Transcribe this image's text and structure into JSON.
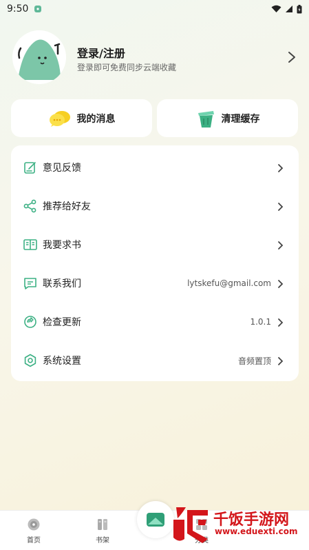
{
  "status_bar": {
    "time": "9:50"
  },
  "profile": {
    "title": "登录/注册",
    "subtitle": "登录即可免费同步云端收藏"
  },
  "quick_actions": [
    {
      "label": "我的消息",
      "icon": "speech-bubbles-icon"
    },
    {
      "label": "清理缓存",
      "icon": "trash-bin-icon"
    }
  ],
  "menu": [
    {
      "label": "意见反馈",
      "value": "",
      "icon": "edit-note-icon"
    },
    {
      "label": "推荐给好友",
      "value": "",
      "icon": "share-icon"
    },
    {
      "label": "我要求书",
      "value": "",
      "icon": "book-icon"
    },
    {
      "label": "联系我们",
      "value": "lytskefu@gmail.com",
      "icon": "message-icon"
    },
    {
      "label": "检查更新",
      "value": "1.0.1",
      "icon": "refresh-icon"
    },
    {
      "label": "系统设置",
      "value": "音频置顶",
      "icon": "settings-icon"
    }
  ],
  "bottom_nav": {
    "home": "首页",
    "shelf": "书架",
    "classify": "分类"
  },
  "watermark": {
    "text": "千饭手游网",
    "url": "www.eduexti.com"
  },
  "colors": {
    "accent": "#3bb083",
    "watermark": "#d3161b"
  }
}
